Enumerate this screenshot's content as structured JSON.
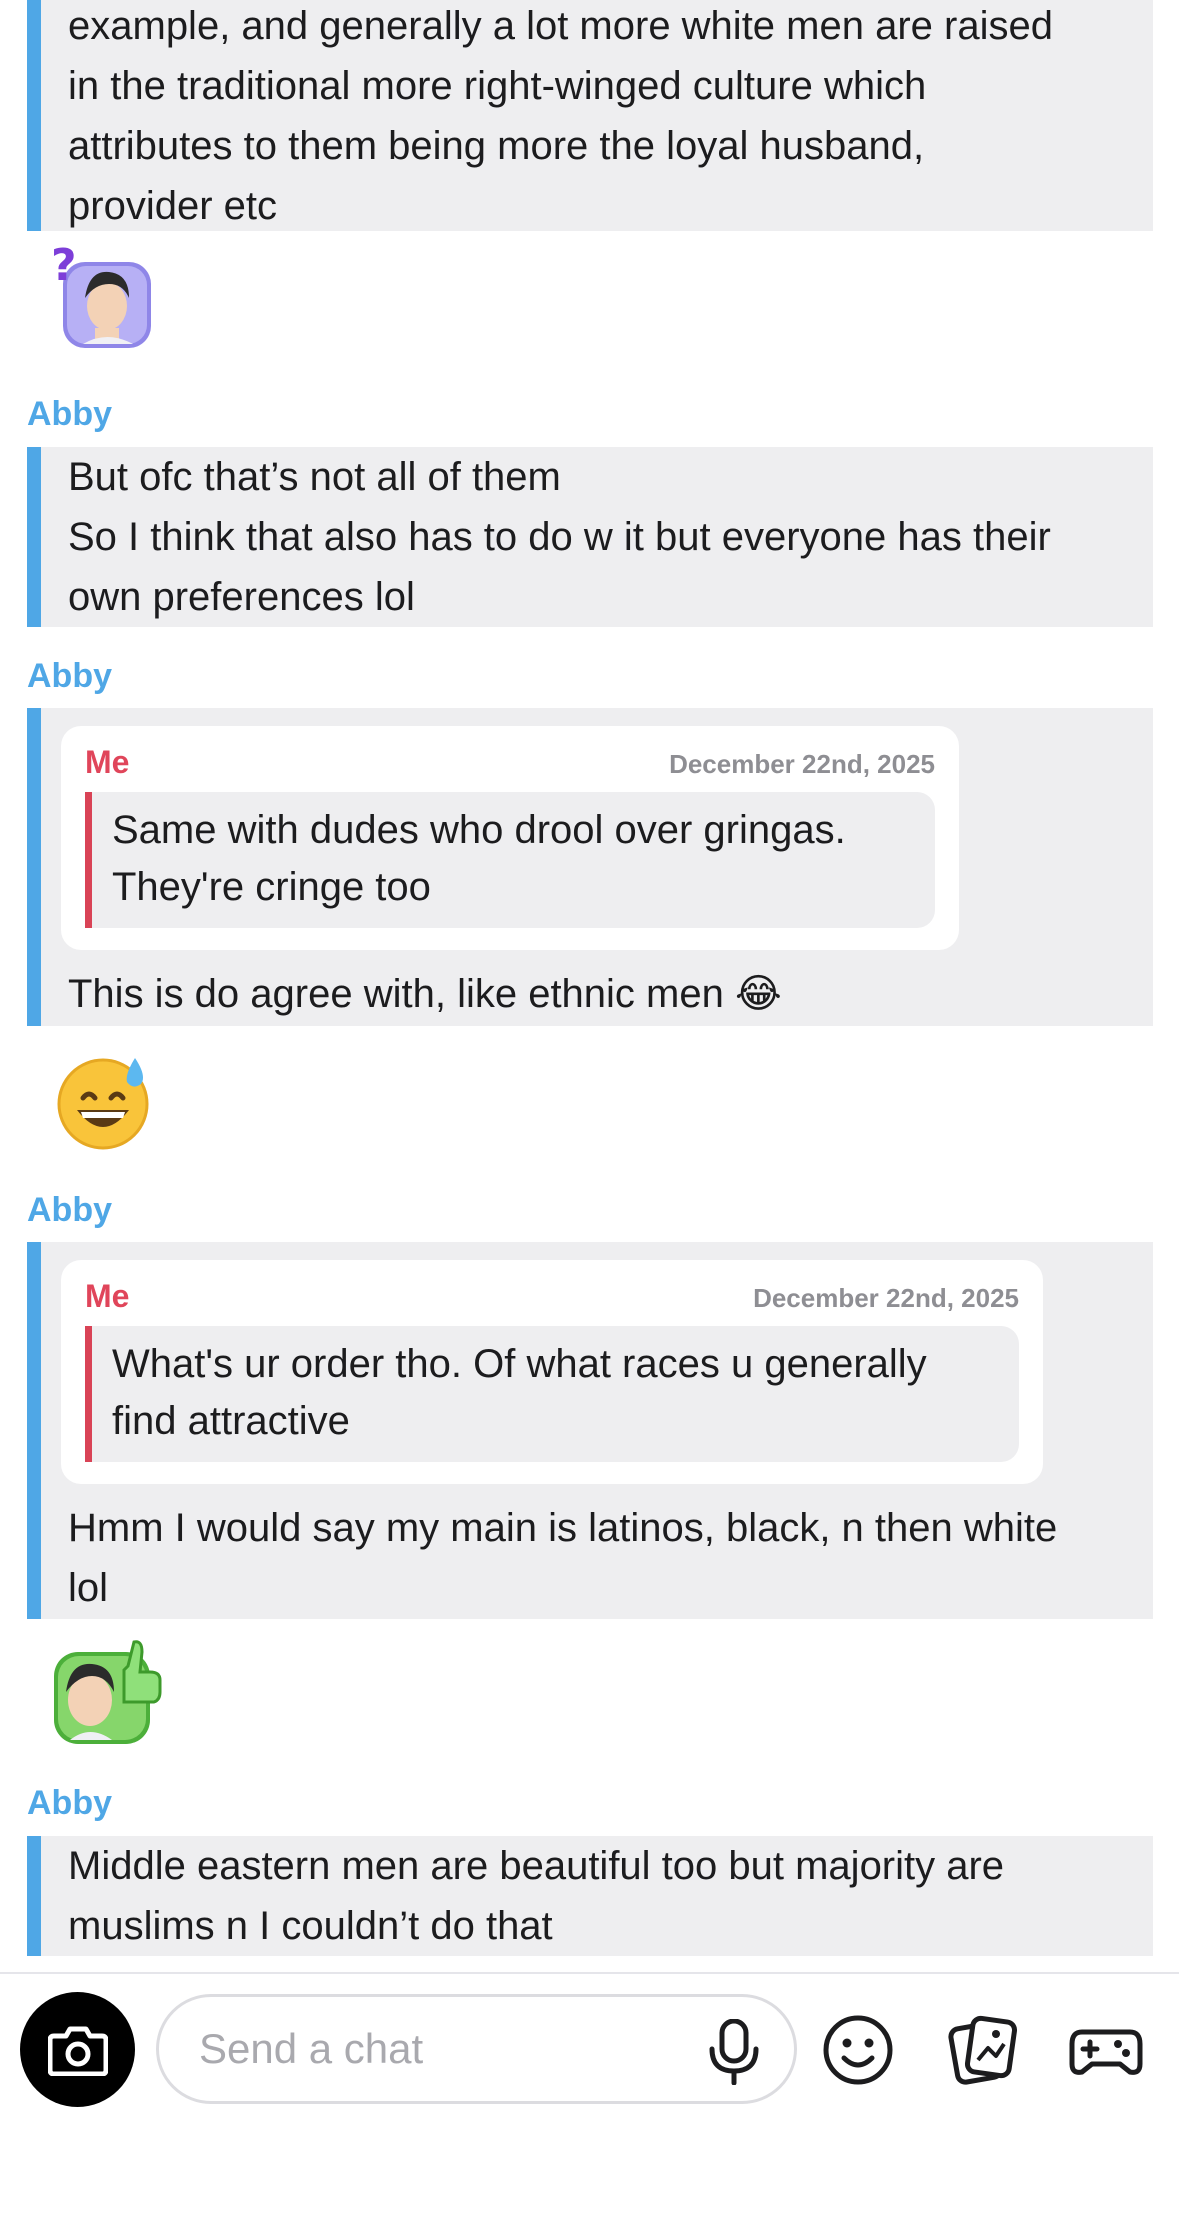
{
  "messages": [
    {
      "sender": "",
      "text": "example, and generally a lot more white men are raised\nin the traditional more right-winged culture which\nattributes to them being more the loyal husband,\nprovider etc"
    },
    {
      "sender": "Abby",
      "text": "But ofc that’s not all of them\nSo I think that also has to do w it but everyone has their\nown preferences lol"
    },
    {
      "sender": "Abby",
      "quote": {
        "sender": "Me",
        "date": "December 22nd, 2025",
        "text": "Same with dudes who drool over gringas.\nThey're cringe too"
      },
      "text": "This is do agree with, like ethnic men 😂"
    },
    {
      "sender": "Abby",
      "quote": {
        "sender": "Me",
        "date": "December 22nd, 2025",
        "text": "What's ur order tho. Of what races u generally\nfind attractive"
      },
      "text": "Hmm I would say my main is latinos, black, n then white\nlol"
    },
    {
      "sender": "Abby",
      "text": "Middle eastern men are beautiful too but majority are\nmuslims n I couldn’t do that"
    }
  ],
  "reactions": {
    "emoji": "😅"
  },
  "composer": {
    "placeholder": "Send a chat"
  },
  "icons": [
    "camera-icon",
    "microphone-icon",
    "smiley-icon",
    "stickers-icon",
    "game-controller-icon"
  ],
  "colors": {
    "accent_blue": "#4fa7e6",
    "quote_red": "#d94356",
    "bubble_bg": "#eeeef0"
  }
}
